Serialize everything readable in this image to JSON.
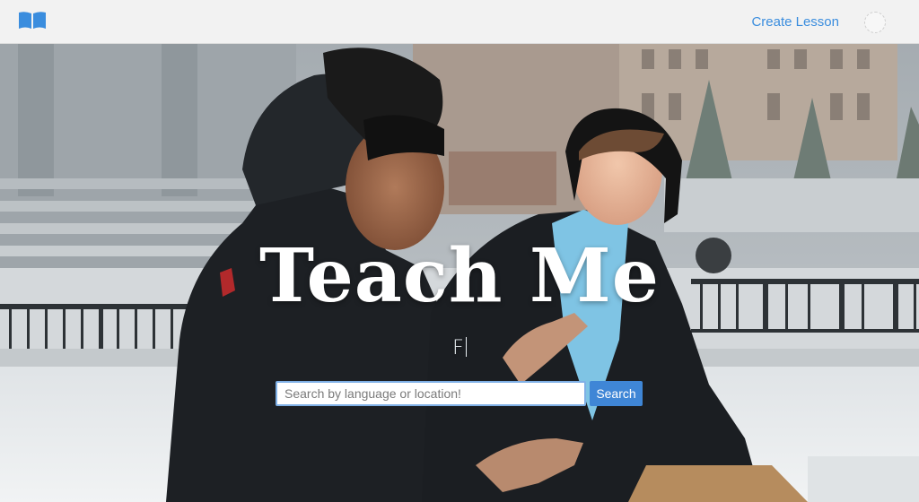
{
  "navbar": {
    "logo_icon": "open-book-icon",
    "create_lesson_label": "Create Lesson",
    "avatar_icon": "user-avatar"
  },
  "hero": {
    "title": "Teach Me",
    "typed_text": "F"
  },
  "search": {
    "placeholder": "Search by language or location!",
    "value": "",
    "button_label": "Search"
  },
  "colors": {
    "accent": "#3f86d6",
    "link": "#3a8dde",
    "navbar_bg": "#f2f2f2"
  }
}
